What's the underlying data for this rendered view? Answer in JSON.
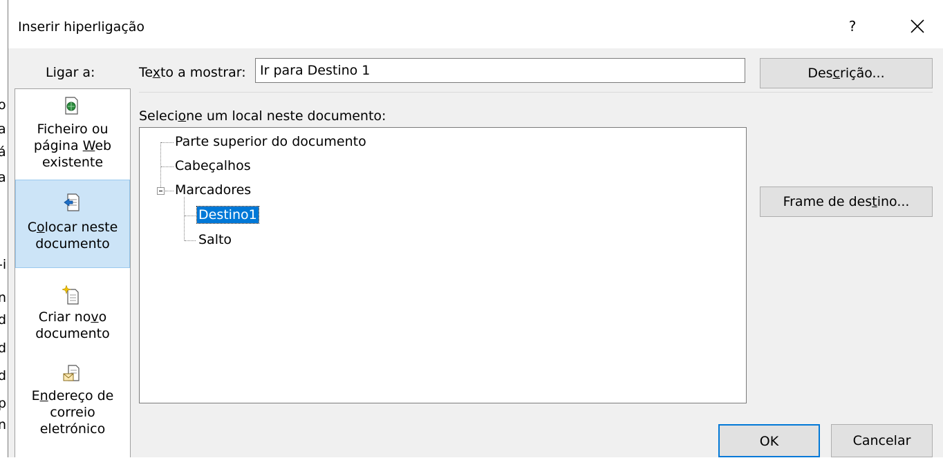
{
  "background_text": [
    "o",
    "a",
    "á",
    "a",
    "-i",
    "n",
    "d",
    "d",
    "d",
    "p",
    "n"
  ],
  "dialog": {
    "title": "Inserir hiperligação",
    "help_label": "?",
    "close_icon": "close-icon"
  },
  "link_to": {
    "label": "Ligar a:",
    "items": [
      {
        "lines": [
          "Ficheiro ou",
          "página Web",
          "existente"
        ],
        "icon": "web-page-icon",
        "selected": false
      },
      {
        "lines": [
          "Colocar neste",
          "documento"
        ],
        "icon": "place-in-document-icon",
        "selected": true
      },
      {
        "lines": [
          "Criar novo",
          "documento"
        ],
        "icon": "new-document-icon",
        "selected": false
      },
      {
        "lines": [
          "Endereço de",
          "correio",
          "eletrónico"
        ],
        "icon": "email-address-icon",
        "selected": false
      }
    ]
  },
  "text_to_display": {
    "label_pre": "Te",
    "label_u": "x",
    "label_post": "to a mostrar:",
    "value": "Ir para Destino 1"
  },
  "buttons": {
    "description": {
      "pre": "Des",
      "u": "c",
      "post": "rição..."
    },
    "target_frame": {
      "pre": "Frame de des",
      "u": "t",
      "post": "ino..."
    },
    "ok": "OK",
    "cancel": "Cancelar"
  },
  "place": {
    "label_pre": "Seleci",
    "label_u": "o",
    "label_post": "ne um local neste documento:",
    "tree": {
      "top": "Parte superior do documento",
      "headings": "Cabeçalhos",
      "bookmarks": "Marcadores",
      "bookmark_items": [
        "Destino1",
        "Salto"
      ]
    }
  },
  "colors": {
    "dialog_bg": "#f0f0f0",
    "selected_nav_bg": "#cce4f7",
    "selected_node_bg": "#0078d7",
    "ok_border": "#0078d7"
  }
}
